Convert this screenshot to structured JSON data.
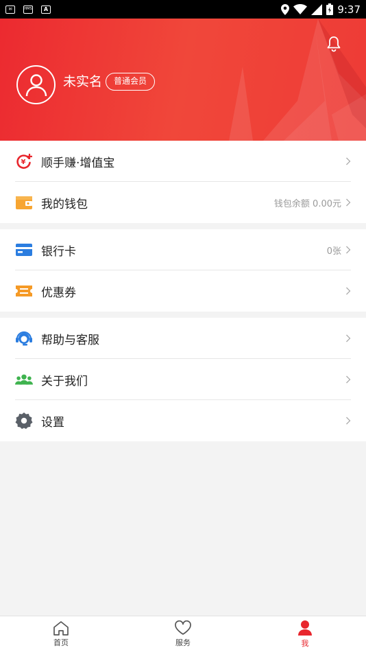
{
  "status_bar": {
    "time": "9:37",
    "icons": [
      "mail-icon",
      "hms-icon",
      "a-icon",
      "location-icon",
      "wifi-icon",
      "signal-icon",
      "battery-icon"
    ],
    "hms_text": "HMS",
    "a_text": "A"
  },
  "header": {
    "username": "未实名",
    "member_level": "普通会员",
    "bell_icon": "bell-icon",
    "avatar_icon": "user-avatar-icon",
    "colors": {
      "background": "#ec2a30"
    }
  },
  "groups": [
    {
      "items": [
        {
          "label": "顺手赚·增值宝",
          "icon": "coin-plus-icon",
          "value": ""
        },
        {
          "label": "我的钱包",
          "icon": "wallet-icon",
          "value": "钱包余额 0.00元"
        }
      ]
    },
    {
      "items": [
        {
          "label": "银行卡",
          "icon": "bank-card-icon",
          "value": "0张"
        },
        {
          "label": "优惠券",
          "icon": "coupon-icon",
          "value": ""
        }
      ]
    },
    {
      "items": [
        {
          "label": "帮助与客服",
          "icon": "headset-icon",
          "value": ""
        },
        {
          "label": "关于我们",
          "icon": "people-icon",
          "value": ""
        },
        {
          "label": "设置",
          "icon": "gear-icon",
          "value": ""
        }
      ]
    }
  ],
  "tabbar": {
    "tabs": [
      {
        "label": "首页",
        "icon": "home-icon"
      },
      {
        "label": "服务",
        "icon": "heart-icon"
      },
      {
        "label": "我",
        "icon": "person-icon",
        "active": true
      }
    ],
    "active_color": "#e8262d"
  }
}
